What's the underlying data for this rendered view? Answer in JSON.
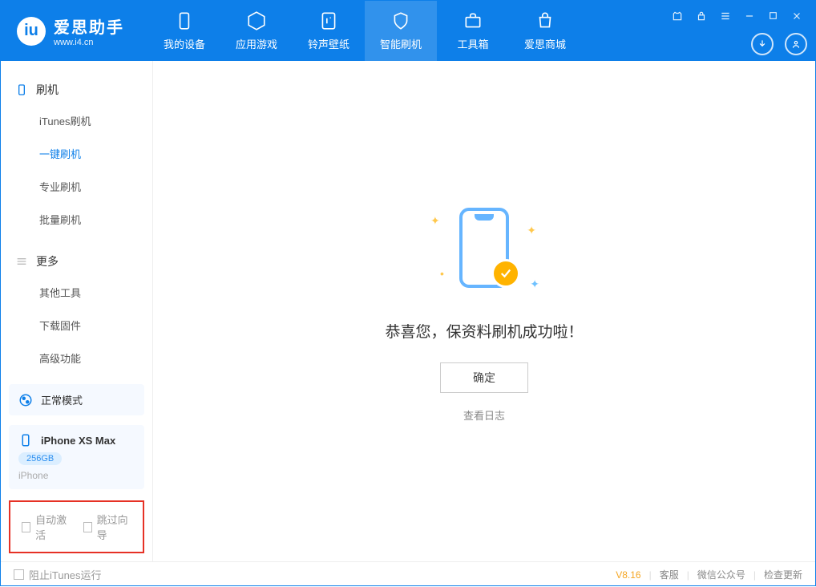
{
  "app": {
    "title": "爱思助手",
    "subtitle": "www.i4.cn"
  },
  "nav": {
    "items": [
      {
        "label": "我的设备"
      },
      {
        "label": "应用游戏"
      },
      {
        "label": "铃声壁纸"
      },
      {
        "label": "智能刷机",
        "active": true
      },
      {
        "label": "工具箱"
      },
      {
        "label": "爱思商城"
      }
    ]
  },
  "sidebar": {
    "section1_title": "刷机",
    "items1": [
      {
        "label": "iTunes刷机"
      },
      {
        "label": "一键刷机",
        "active": true
      },
      {
        "label": "专业刷机"
      },
      {
        "label": "批量刷机"
      }
    ],
    "section2_title": "更多",
    "items2": [
      {
        "label": "其他工具"
      },
      {
        "label": "下载固件"
      },
      {
        "label": "高级功能"
      }
    ],
    "mode_label": "正常模式",
    "device_name": "iPhone XS Max",
    "device_storage": "256GB",
    "device_type": "iPhone",
    "cb1": "自动激活",
    "cb2": "跳过向导"
  },
  "main": {
    "success_text": "恭喜您，保资料刷机成功啦！",
    "ok_button": "确定",
    "log_link": "查看日志"
  },
  "footer": {
    "stop_itunes": "阻止iTunes运行",
    "version": "V8.16",
    "link1": "客服",
    "link2": "微信公众号",
    "link3": "检查更新"
  }
}
